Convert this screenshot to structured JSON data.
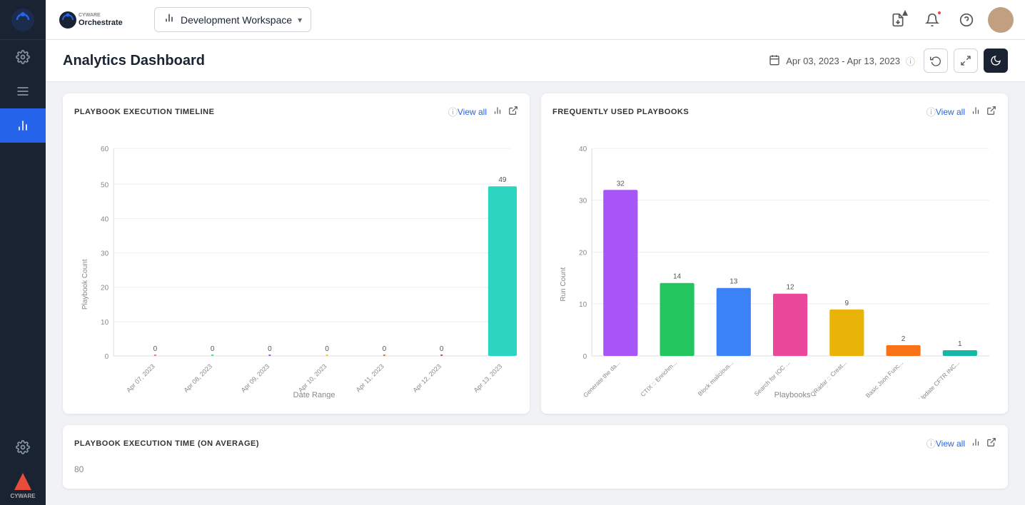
{
  "sidebar": {
    "logo_text": "CYWARE",
    "items": [
      {
        "id": "settings-top",
        "icon": "⚙",
        "label": "Settings",
        "active": false
      },
      {
        "id": "menu",
        "icon": "☰",
        "label": "Menu",
        "active": false
      },
      {
        "id": "analytics",
        "icon": "📊",
        "label": "Analytics",
        "active": true
      },
      {
        "id": "settings-bottom",
        "icon": "⚙",
        "label": "Settings",
        "active": false
      }
    ]
  },
  "topnav": {
    "workspace_label": "Development Workspace",
    "nav_icons": [
      "📋",
      "🔔",
      "❓"
    ],
    "avatar_initial": "👤"
  },
  "page_header": {
    "title": "Analytics Dashboard",
    "date_range": "Apr 03, 2023  -  Apr 13, 2023",
    "info_icon": "ℹ",
    "refresh_icon": "↻",
    "expand_icon": "⛶",
    "moon_icon": "🌙"
  },
  "playbook_timeline": {
    "title": "PLAYBOOK EXECUTION TIMELINE",
    "view_all": "View all",
    "y_label": "Playbook Count",
    "x_label": "Date Range",
    "bars": [
      {
        "date": "Apr 07, 2023",
        "value": 0,
        "color": "#e879a0"
      },
      {
        "date": "Apr 08, 2023",
        "value": 0,
        "color": "#4ade80"
      },
      {
        "date": "Apr 09, 2023",
        "value": 0,
        "color": "#a855f7"
      },
      {
        "date": "Apr 10, 2023",
        "value": 0,
        "color": "#facc15"
      },
      {
        "date": "Apr 11, 2023",
        "value": 0,
        "color": "#f97316"
      },
      {
        "date": "Apr 12, 2023",
        "value": 0,
        "color": "#ef4444"
      },
      {
        "date": "Apr 13, 2023",
        "value": 49,
        "color": "#2dd4bf"
      }
    ],
    "y_ticks": [
      0,
      10,
      20,
      30,
      40,
      50,
      60
    ],
    "max_value": 60
  },
  "frequently_used": {
    "title": "FREQUENTLY USED PLAYBOOKS",
    "view_all": "View all",
    "y_label": "Run Count",
    "x_label": "Playbooks",
    "bars": [
      {
        "label": "Generate the da...",
        "value": 32,
        "color": "#a855f7"
      },
      {
        "label": "CTIX :: Enrichm...",
        "value": 14,
        "color": "#22c55e"
      },
      {
        "label": "Block malicious...",
        "value": 13,
        "color": "#3b82f6"
      },
      {
        "label": "Search for IOC ...",
        "value": 12,
        "color": "#ec4899"
      },
      {
        "label": "QRadar :: Creat...",
        "value": 9,
        "color": "#eab308"
      },
      {
        "label": "Basic Json Func...",
        "value": 2,
        "color": "#f97316"
      },
      {
        "label": "Update CFTR INC...",
        "value": 1,
        "color": "#14b8a6"
      }
    ],
    "y_ticks": [
      0,
      10,
      20,
      30,
      40
    ],
    "max_value": 40
  },
  "bottom_section": {
    "title": "PLAYBOOK EXECUTION TIME (ON AVERAGE)",
    "view_all": "View all",
    "info_icon": "ℹ"
  }
}
